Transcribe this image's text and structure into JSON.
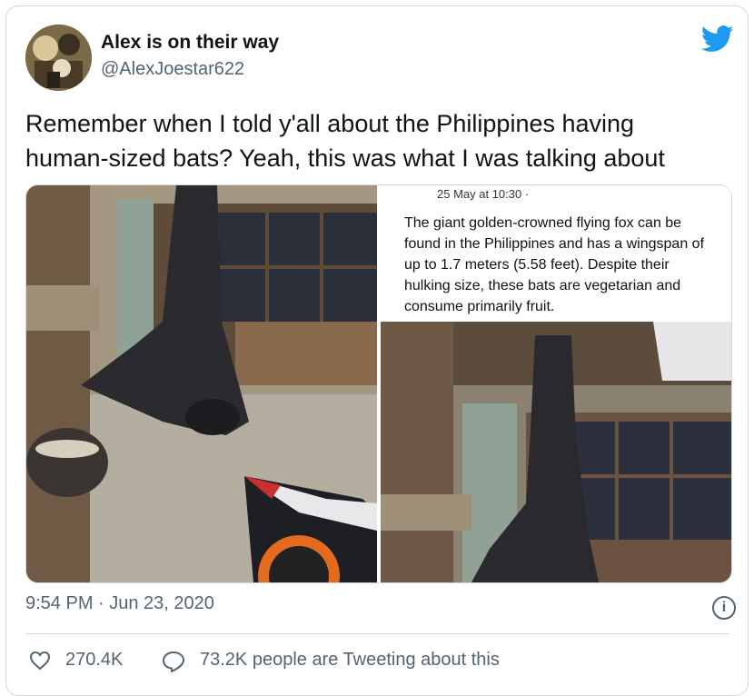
{
  "tweet": {
    "display_name": "Alex is on their way",
    "handle": "@AlexJoestar622",
    "text_line1": "Remember when I told y'all about the Philippines having",
    "text_line2": "human-sized bats? Yeah, this was what I was talking about",
    "timestamp": "9:54 PM · Jun 23, 2020",
    "likes": "270.4K",
    "tweeting_text": "73.2K people are Tweeting about this"
  },
  "media": {
    "caption_date": "25 May at 10:30 ·",
    "caption_text": "The giant golden-crowned flying fox can be found in the Philippines and has a wingspan of up to 1.7 meters (5.58 feet). Despite their hulking size, these bats are vegetarian and consume primarily fruit."
  },
  "icons": {
    "brand": "twitter-bird-icon",
    "info": "info-icon",
    "like": "heart-icon",
    "reply": "speech-bubble-icon"
  },
  "colors": {
    "brand": "#1d9bf0",
    "secondary_text": "#536471",
    "border": "#cfd9de"
  }
}
